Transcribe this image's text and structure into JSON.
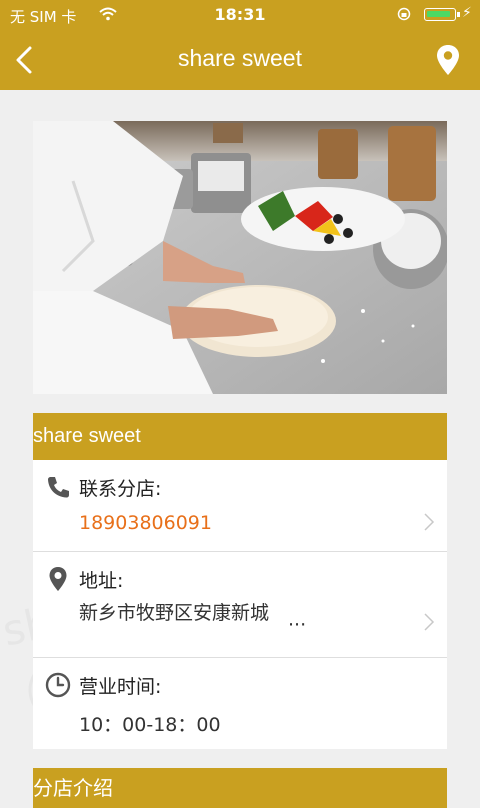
{
  "status_bar": {
    "carrier": "无 SIM 卡",
    "time": "18:31",
    "battery_level": 0.9,
    "icons": [
      "wifi-icon",
      "rotation-lock-icon",
      "battery-icon",
      "charging-icon"
    ]
  },
  "nav": {
    "title": "share sweet",
    "back_icon": "chevron-left-icon",
    "location_icon": "location-pin-icon"
  },
  "hero_image": {
    "description_icon": "chef-kneading-dough-photo"
  },
  "store": {
    "name": "share sweet",
    "contact_label": "联系分店:",
    "phone": "18903806091",
    "address_label": "地址:",
    "address": "新乡市牧野区安康新城",
    "address_more": "···",
    "hours_label": "营业时间:",
    "hours": "10：00-18：00"
  },
  "section_intro": {
    "title": "分店介绍"
  },
  "colors": {
    "brand": "#c9a020",
    "phone": "#e8701a",
    "background": "#efefef"
  }
}
